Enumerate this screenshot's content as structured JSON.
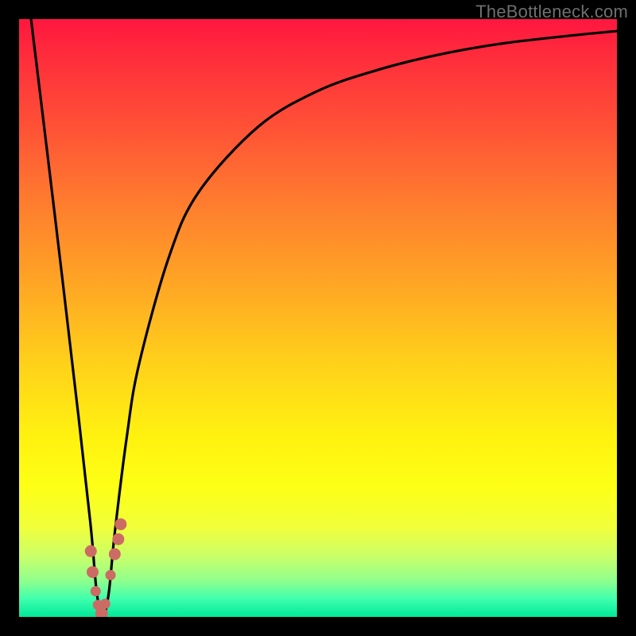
{
  "watermark": "TheBottleneck.com",
  "chart_data": {
    "type": "line",
    "title": "",
    "xlabel": "",
    "ylabel": "",
    "xlim": [
      0,
      100
    ],
    "ylim": [
      0,
      100
    ],
    "series": [
      {
        "name": "bottleneck-curve",
        "x": [
          2,
          6,
          10,
          12,
          13,
          14,
          15,
          16,
          18,
          20,
          25,
          30,
          40,
          50,
          60,
          70,
          80,
          90,
          100
        ],
        "values": [
          100,
          67,
          33,
          15,
          4,
          0,
          4,
          14,
          30,
          42,
          60,
          71,
          82,
          88,
          91.5,
          94,
          95.8,
          97,
          98
        ]
      }
    ],
    "marker_points": {
      "name": "highlight-dots",
      "x": [
        12.0,
        12.3,
        12.8,
        13.2,
        13.6,
        14.0,
        14.4,
        15.3,
        16.0,
        16.6,
        17.0
      ],
      "values": [
        11.0,
        7.5,
        4.3,
        2.0,
        0.6,
        0.6,
        2.2,
        7.0,
        10.5,
        13.0,
        15.5
      ]
    },
    "gradient_stops": [
      {
        "pct": 0,
        "color": "#ff163f"
      },
      {
        "pct": 18,
        "color": "#ff5136"
      },
      {
        "pct": 45,
        "color": "#ffa824"
      },
      {
        "pct": 70,
        "color": "#fff210"
      },
      {
        "pct": 90,
        "color": "#c8ff6a"
      },
      {
        "pct": 100,
        "color": "#00e89a"
      }
    ]
  }
}
